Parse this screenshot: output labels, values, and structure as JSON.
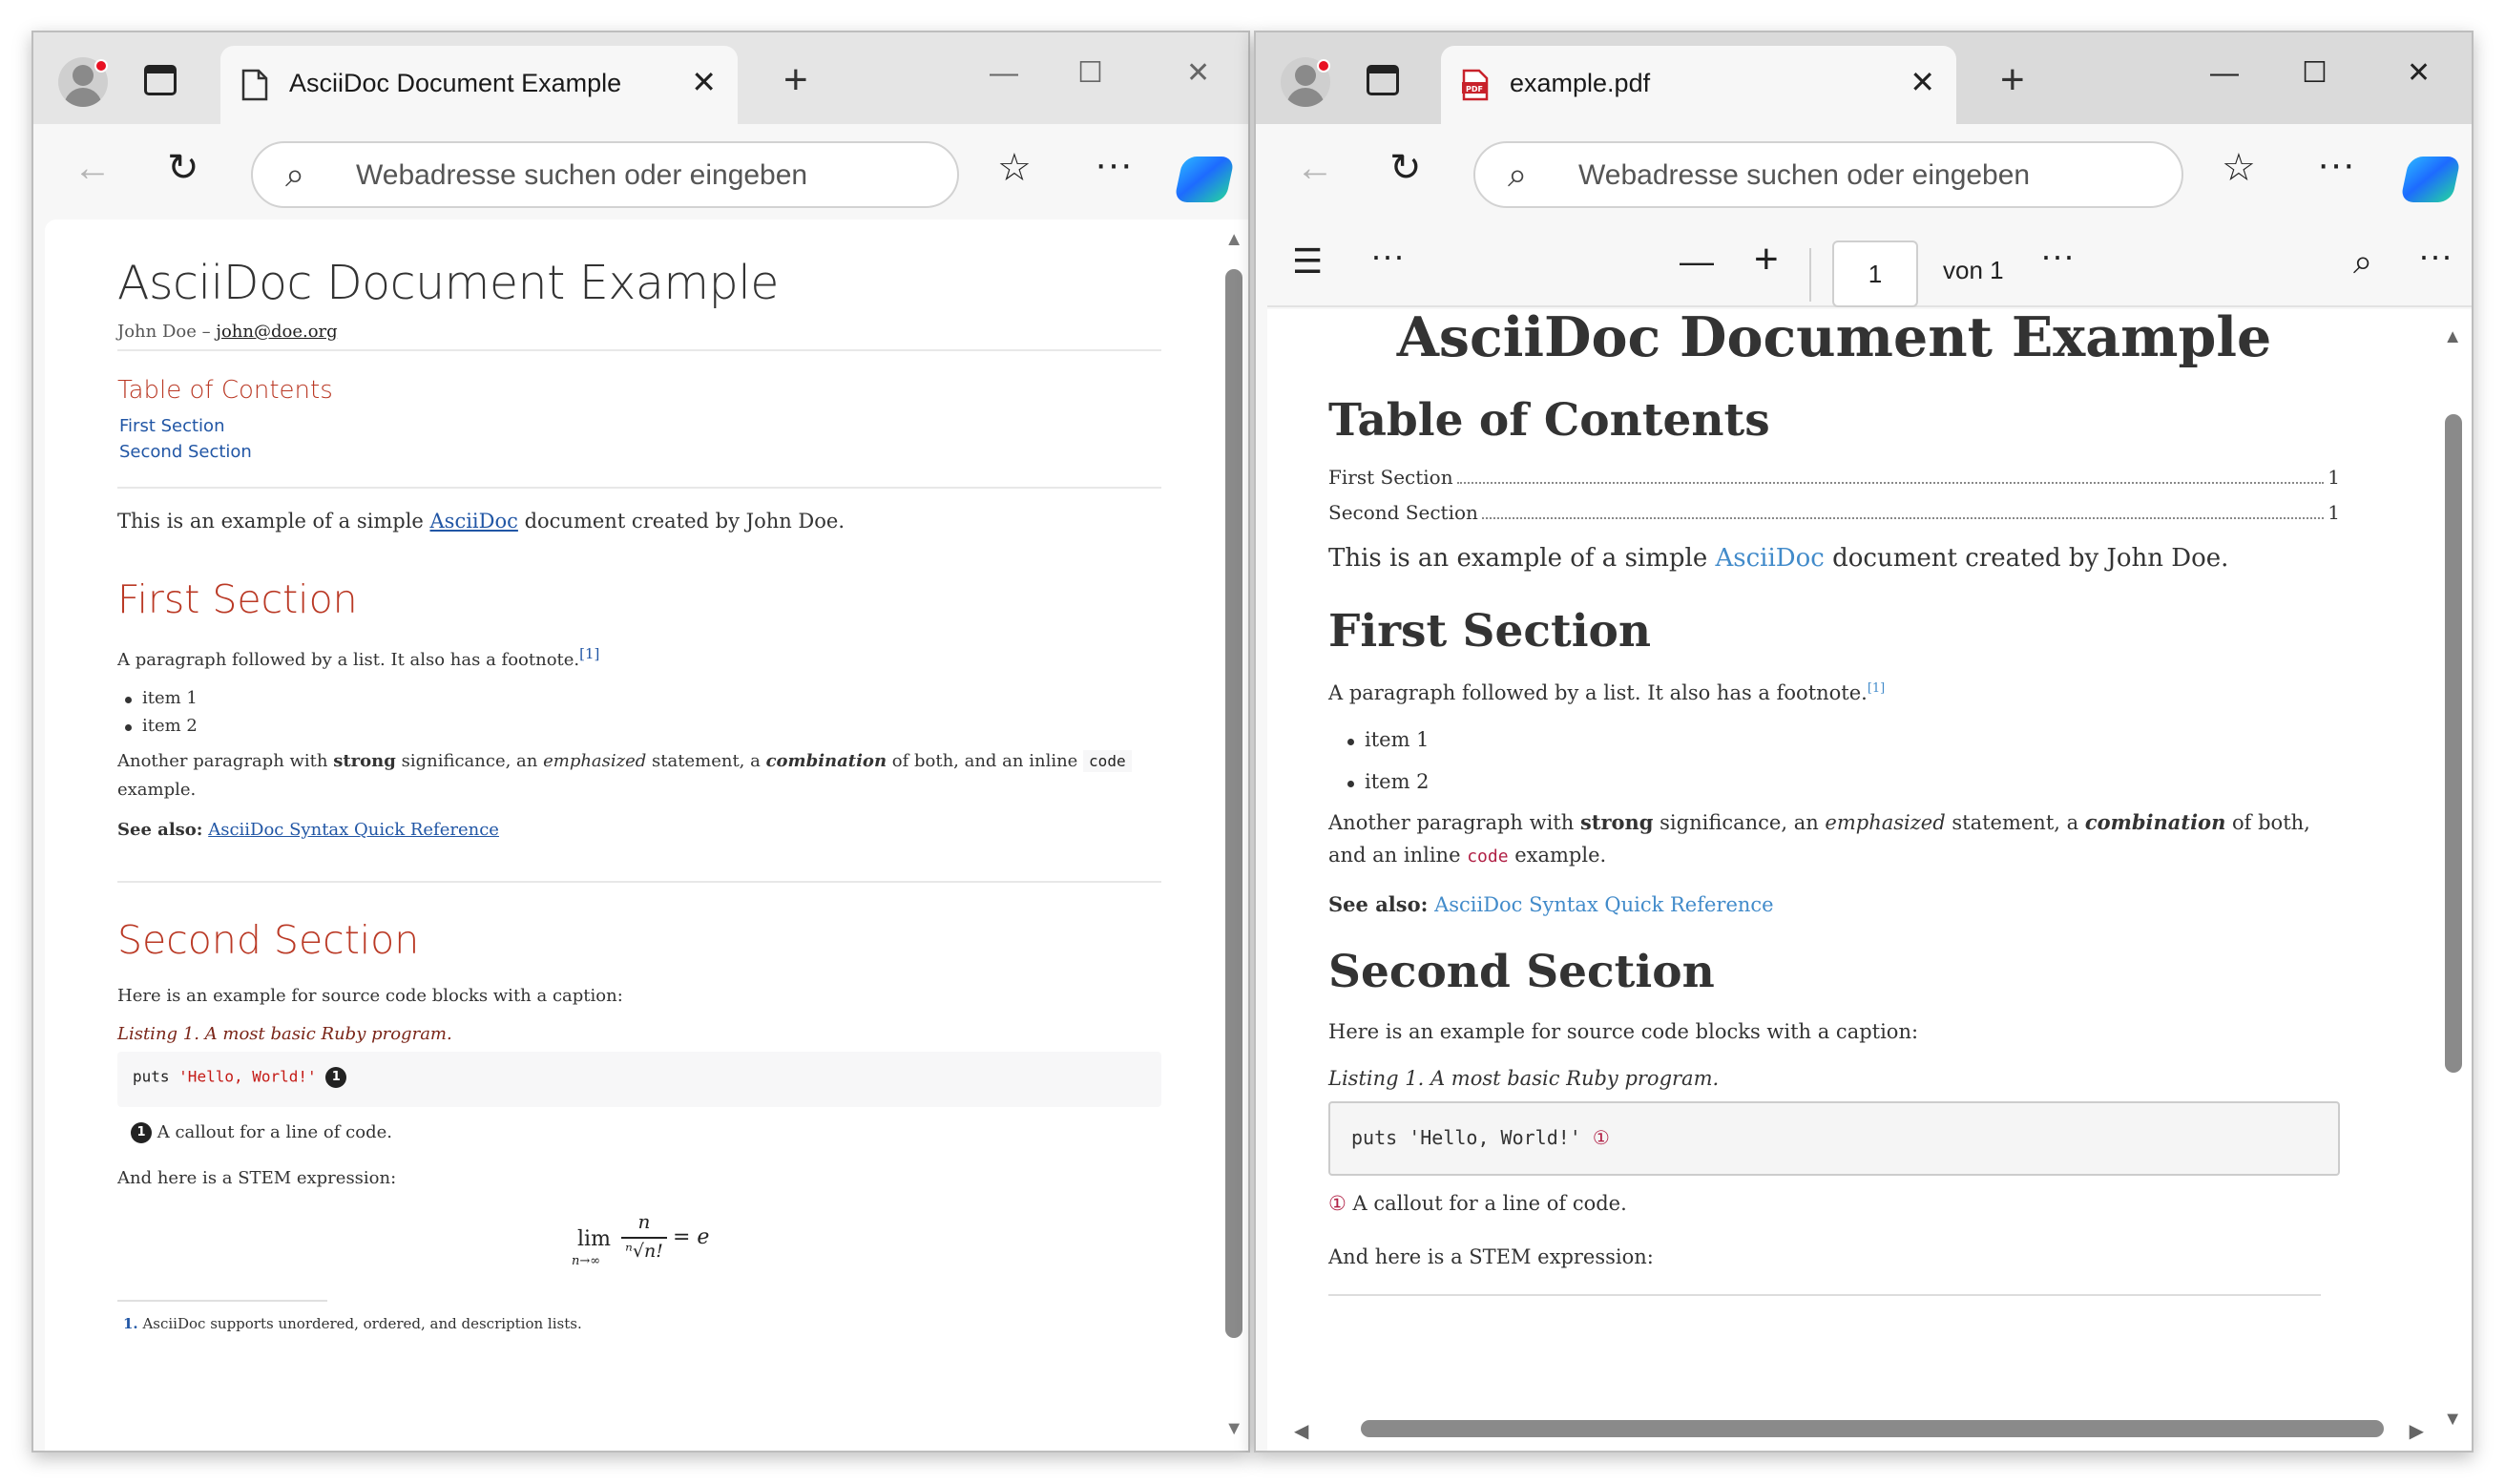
{
  "left": {
    "tab_title": "AsciiDoc Document Example",
    "address_placeholder": "Webadresse suchen oder eingeben",
    "doc": {
      "title": "AsciiDoc Document Example",
      "author": "John Doe",
      "author_sep": "–",
      "email": "john@doe.org",
      "toc_title": "Table of Contents",
      "toc_items": [
        "First Section",
        "Second Section"
      ],
      "intro_pre": "This is an example of a simple ",
      "intro_link": "AsciiDoc",
      "intro_post": " document created by John Doe.",
      "s1_title": "First Section",
      "s1_p1": "A paragraph followed by a list. It also has a footnote.",
      "s1_fn_ref": "[1]",
      "items": [
        "item 1",
        "item 2"
      ],
      "p2_a": "Another paragraph with ",
      "p2_strong": "strong",
      "p2_b": " significance, an ",
      "p2_em": "emphasized",
      "p2_c": " statement, a ",
      "p2_combo": "combination",
      "p2_d": " of both, and an inline ",
      "p2_code": "code",
      "p2_e": " example.",
      "see_also_label": "See also:",
      "see_also_link": "AsciiDoc Syntax Quick Reference",
      "s2_title": "Second Section",
      "s2_p1": "Here is an example for source code blocks with a caption:",
      "listing_caption": "Listing 1. A most basic Ruby program.",
      "code_kw": "puts",
      "code_str": "'Hello, World!'",
      "conum": "1",
      "callout_text": "A callout for a line of code.",
      "stem_intro": "And here is a STEM expression:",
      "math_lim": "lim",
      "math_sub": "n→∞",
      "math_num": "n",
      "math_den": "ⁿ√n!",
      "math_eq": "= e",
      "footnote_num": "1.",
      "footnote_text": "AsciiDoc supports unordered, ordered, and description lists."
    }
  },
  "right": {
    "tab_title": "example.pdf",
    "address_placeholder": "Webadresse suchen oder eingeben",
    "pdf_toolbar": {
      "page_current": "1",
      "page_of": "von 1"
    },
    "pdf": {
      "title": "AsciiDoc Document Example",
      "toc_title": "Table of Contents",
      "toc_items": [
        {
          "label": "First Section",
          "page": "1"
        },
        {
          "label": "Second Section",
          "page": "1"
        }
      ],
      "intro_pre": "This is an example of a simple ",
      "intro_link": "AsciiDoc",
      "intro_post": " document created by John Doe.",
      "s1_title": "First Section",
      "s1_p1": "A paragraph followed by a list. It also has a footnote.",
      "s1_fn_ref": "[1]",
      "items": [
        "item 1",
        "item 2"
      ],
      "p2_a": "Another paragraph with ",
      "p2_strong": "strong",
      "p2_b": " significance, an ",
      "p2_em": "emphasized",
      "p2_c": " statement, a ",
      "p2_combo": "combination",
      "p2_d": " of both, and an inline ",
      "p2_code": "code",
      "p2_e": " example.",
      "see_also_label": "See also:",
      "see_also_link": "AsciiDoc Syntax Quick Reference",
      "s2_title": "Second Section",
      "s2_p1": "Here is an example for source code blocks with a caption:",
      "listing_caption": "Listing 1. A most basic Ruby program.",
      "code_line": "puts 'Hello, World!'",
      "conum": "①",
      "callout_text": "A callout for a line of code.",
      "stem_intro": "And here is a STEM expression:"
    }
  },
  "icons": {
    "close": "✕",
    "plus": "+",
    "minimize": "—",
    "maximize": "☐",
    "back": "←",
    "refresh": "↻",
    "search": "⌕",
    "favorites": "☆",
    "more": "···",
    "toc_list": "☰",
    "zoom_out": "—",
    "zoom_in": "+"
  }
}
